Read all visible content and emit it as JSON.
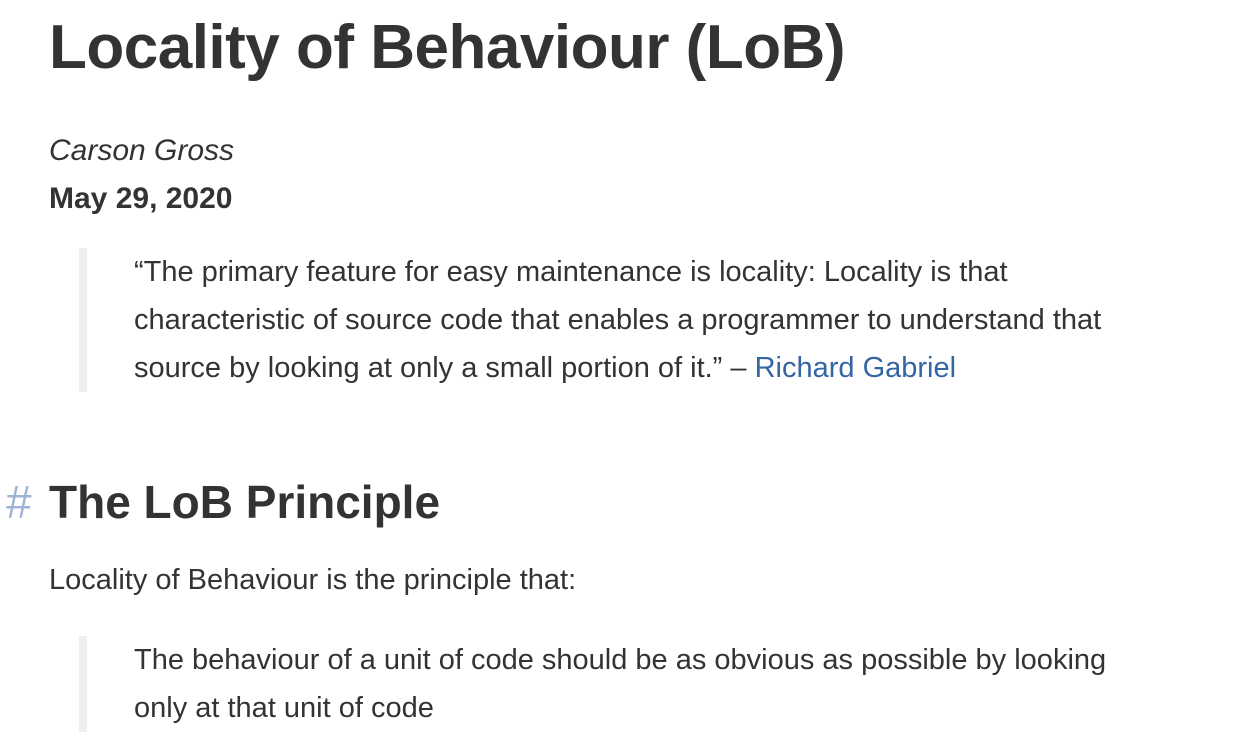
{
  "article": {
    "title": "Locality of Behaviour (LoB)",
    "author": "Carson Gross",
    "date": "May 29, 2020",
    "epigraph": {
      "lines": [
        "“The primary feature for easy maintenance is locality: Locality is that",
        "characteristic of source code that enables a programmer to understand that",
        "source by looking at only a small portion of it.” – "
      ],
      "attribution_link": "Richard Gabriel"
    },
    "section": {
      "anchor": "#",
      "heading": "The LoB Principle",
      "intro": "Locality of Behaviour is the principle that:",
      "quote_lines": [
        "The behaviour of a unit of code should be as obvious as possible by looking",
        "only at that unit of code"
      ]
    }
  },
  "colors": {
    "text": "#333333",
    "link": "#3465a4",
    "anchor": "#9fb3d6",
    "quote_border": "#eeeeee"
  }
}
